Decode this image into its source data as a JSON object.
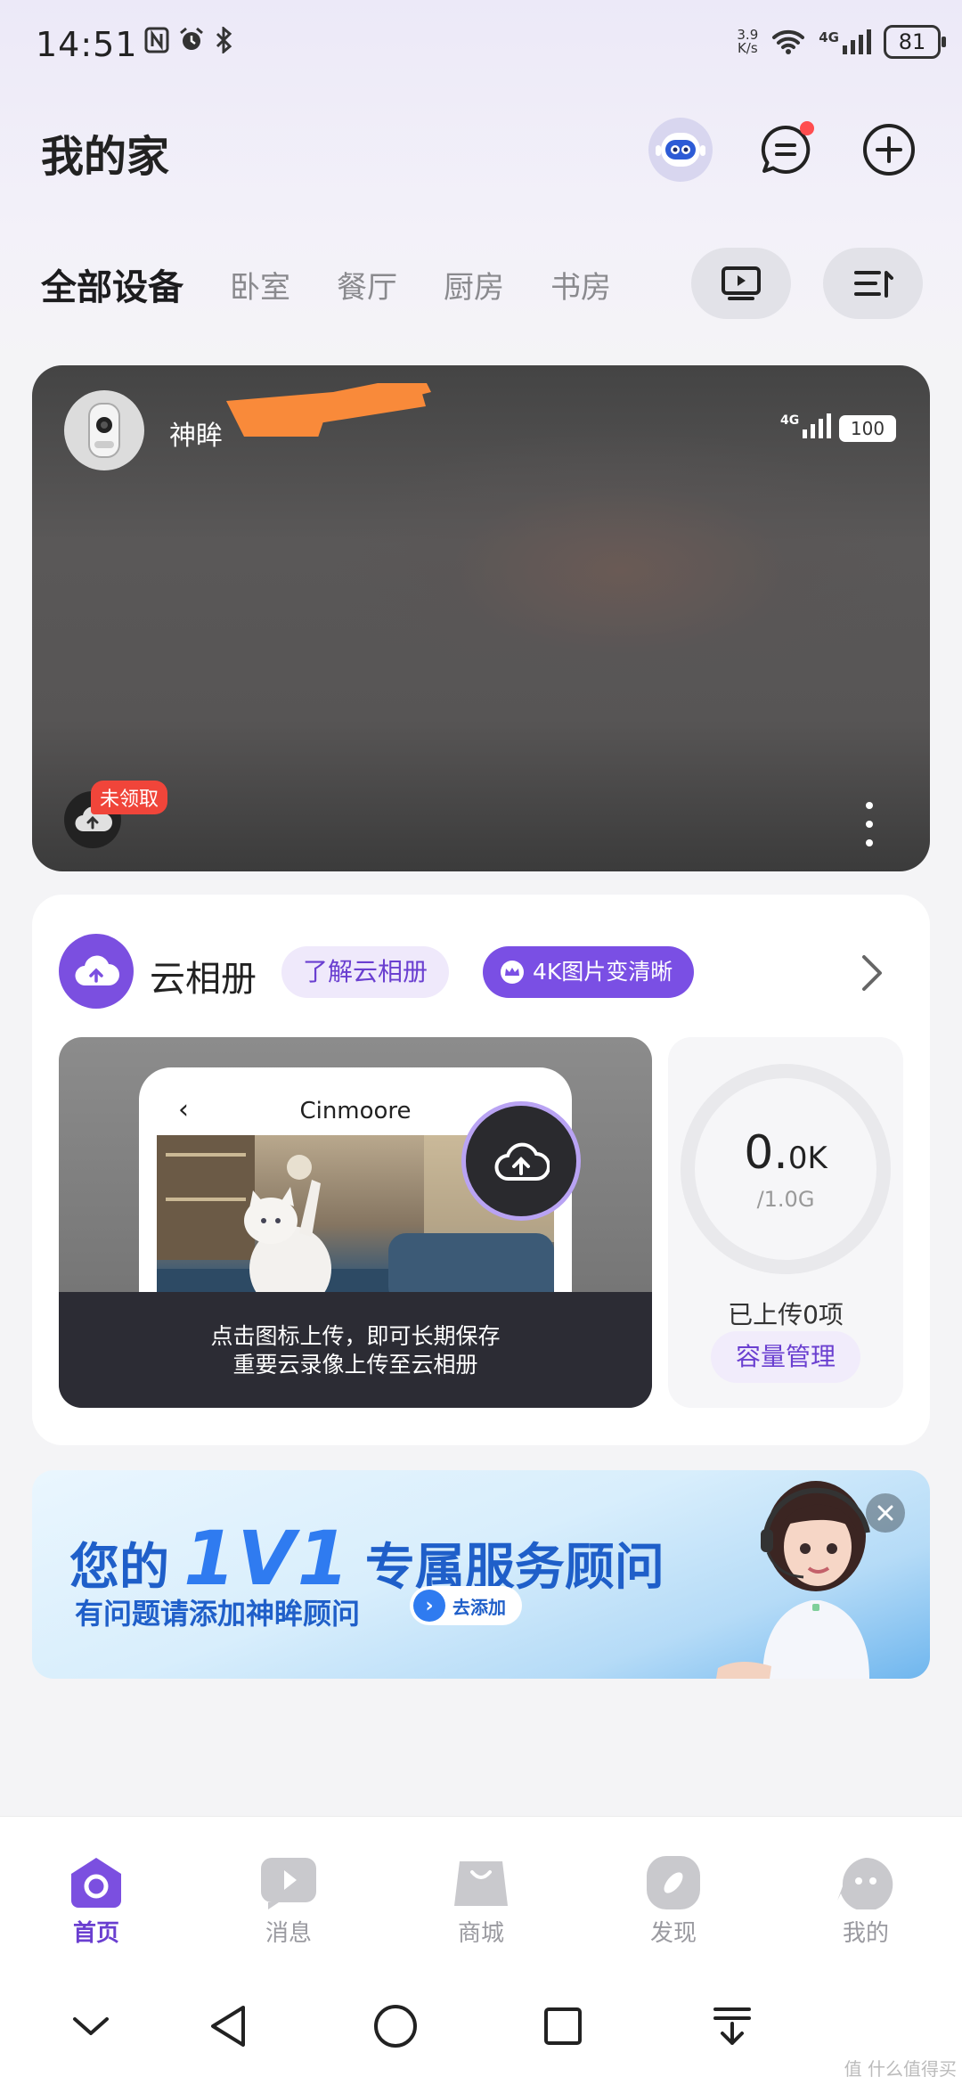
{
  "status_bar": {
    "time": "14:51",
    "net_speed_value": "3.9",
    "net_speed_unit": "K/s",
    "network": "4G",
    "battery": "81"
  },
  "header": {
    "title": "我的家"
  },
  "tabs": {
    "items": [
      "全部设备",
      "卧室",
      "餐厅",
      "厨房",
      "书房"
    ]
  },
  "camera": {
    "name": "神眸",
    "network": "4G",
    "battery": "100",
    "badge": "未领取"
  },
  "album": {
    "title": "云相册",
    "learn_label": "了解云相册",
    "hd_label": "4K图片变清晰",
    "phone_title": "Cinmoore",
    "caption_line1": "点击图标上传，即可长期保存",
    "caption_line2": "重要云录像上传至云相册",
    "used_main": "0.",
    "used_small": "0K",
    "total": "/1.0G",
    "uploaded": "已上传0项",
    "manage_label": "容量管理"
  },
  "banner": {
    "prefix": "您的",
    "big": "1V1",
    "suffix": "专属服务顾问",
    "line2": "有问题请添加神眸顾问",
    "add_label": "去添加"
  },
  "bottom_nav": {
    "items": [
      "首页",
      "消息",
      "商城",
      "发现",
      "我的"
    ]
  },
  "watermark": "值 什么值得买",
  "colors": {
    "accent": "#7b4fe0",
    "badge_red": "#f0453a",
    "banner_blue": "#1f5fc9"
  }
}
